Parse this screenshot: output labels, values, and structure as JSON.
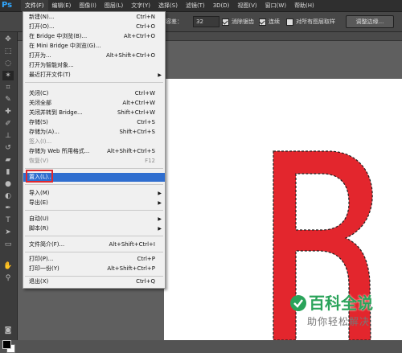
{
  "app": {
    "logo": "Ps"
  },
  "menubar": {
    "items": [
      "文件(F)",
      "编辑(E)",
      "图像(I)",
      "图层(L)",
      "文字(Y)",
      "选择(S)",
      "滤镜(T)",
      "3D(D)",
      "视图(V)",
      "窗口(W)",
      "帮助(H)"
    ]
  },
  "options": {
    "tolerance_label": "容差：",
    "tolerance_value": "32",
    "anti_alias": "消除锯齿",
    "contiguous": "连续",
    "sample_all": "对所有图层取样",
    "refine_edge": "调整边缘..."
  },
  "file_menu": {
    "items": [
      {
        "label": "新建(N)...",
        "shortcut": "Ctrl+N"
      },
      {
        "label": "打开(O)...",
        "shortcut": "Ctrl+O"
      },
      {
        "label": "在 Bridge 中浏览(B)...",
        "shortcut": "Alt+Ctrl+O"
      },
      {
        "label": "在 Mini Bridge 中浏览(G)...",
        "shortcut": ""
      },
      {
        "label": "打开为...",
        "shortcut": "Alt+Shift+Ctrl+O"
      },
      {
        "label": "打开为智能对象...",
        "shortcut": ""
      },
      {
        "label": "最近打开文件(T)",
        "shortcut": ""
      },
      {
        "label": "关闭(C)",
        "shortcut": "Ctrl+W"
      },
      {
        "label": "关闭全部",
        "shortcut": "Alt+Ctrl+W"
      },
      {
        "label": "关闭并转到 Bridge...",
        "shortcut": "Shift+Ctrl+W"
      },
      {
        "label": "存储(S)",
        "shortcut": "Ctrl+S"
      },
      {
        "label": "存储为(A)...",
        "shortcut": "Shift+Ctrl+S"
      },
      {
        "label": "签入(I)...",
        "shortcut": ""
      },
      {
        "label": "存储为 Web 所用格式...",
        "shortcut": "Alt+Shift+Ctrl+S"
      },
      {
        "label": "恢复(V)",
        "shortcut": "F12"
      },
      {
        "label": "置入(L)...",
        "shortcut": ""
      },
      {
        "label": "导入(M)",
        "shortcut": ""
      },
      {
        "label": "导出(E)",
        "shortcut": ""
      },
      {
        "label": "自动(U)",
        "shortcut": ""
      },
      {
        "label": "脚本(R)",
        "shortcut": ""
      },
      {
        "label": "文件简介(F)...",
        "shortcut": "Alt+Shift+Ctrl+I"
      },
      {
        "label": "打印(P)...",
        "shortcut": "Ctrl+P"
      },
      {
        "label": "打印一份(Y)",
        "shortcut": "Alt+Shift+Ctrl+P"
      },
      {
        "label": "退出(X)",
        "shortcut": "Ctrl+Q"
      }
    ]
  },
  "canvas": {
    "letter": "R",
    "letter_color": "#e3262d"
  },
  "watermark": {
    "title": "百科全说",
    "subtitle": "助你轻松解决",
    "color": "#2aa35a"
  }
}
